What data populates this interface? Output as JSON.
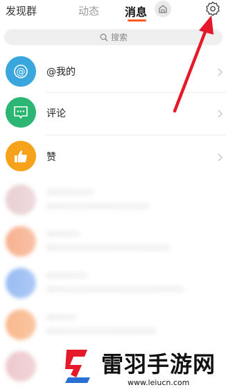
{
  "header": {
    "discover_label": "发现群",
    "tabs": [
      {
        "label": "动态",
        "active": false
      },
      {
        "label": "消息",
        "active": true
      }
    ],
    "accent": "#ff5a1f"
  },
  "search": {
    "placeholder": "搜索"
  },
  "entries": [
    {
      "label": "@我的",
      "icon": "at-icon",
      "color": "#39a6dd"
    },
    {
      "label": "评论",
      "icon": "comment-icon",
      "color": "#2bb673"
    },
    {
      "label": "赞",
      "icon": "thumbs-up-icon",
      "color": "#f7a21b"
    }
  ],
  "watermark": {
    "title": "雷羽手游网",
    "url": "www.leiucn.com"
  },
  "annotation": {
    "arrow_color": "#e5192a",
    "target": "gear-icon"
  }
}
